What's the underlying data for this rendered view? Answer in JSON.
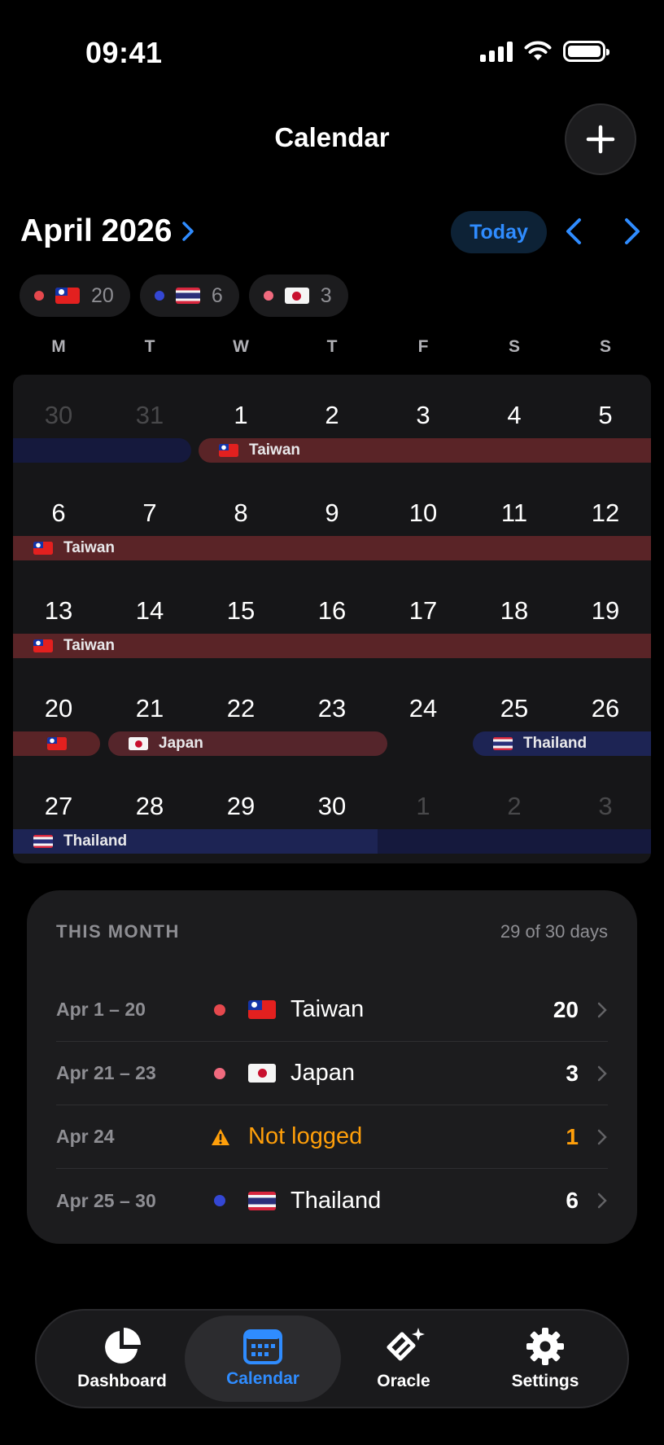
{
  "status": {
    "time": "09:41"
  },
  "nav": {
    "title": "Calendar"
  },
  "month": {
    "title": "April 2026",
    "today_label": "Today"
  },
  "chips": [
    {
      "dot_color": "#e5484d",
      "flag": "taiwan",
      "count": "20"
    },
    {
      "dot_color": "#3447d4",
      "flag": "thailand",
      "count": "6"
    },
    {
      "dot_color": "#f06a7e",
      "flag": "japan",
      "count": "3"
    }
  ],
  "weekdays": [
    "M",
    "T",
    "W",
    "T",
    "F",
    "S",
    "S"
  ],
  "weeks": [
    [
      "30",
      "31",
      "1",
      "2",
      "3",
      "4",
      "5"
    ],
    [
      "6",
      "7",
      "8",
      "9",
      "10",
      "11",
      "12"
    ],
    [
      "13",
      "14",
      "15",
      "16",
      "17",
      "18",
      "19"
    ],
    [
      "20",
      "21",
      "22",
      "23",
      "24",
      "25",
      "26"
    ],
    [
      "27",
      "28",
      "29",
      "30",
      "1",
      "2",
      "3"
    ]
  ],
  "bar_labels": {
    "taiwan": "Taiwan",
    "japan": "Japan",
    "thailand": "Thailand"
  },
  "summary": {
    "title": "THIS MONTH",
    "subtitle": "29 of 30 days",
    "rows": [
      {
        "range": "Apr 1 – 20",
        "place": "Taiwan",
        "count": "20",
        "dot_color": "#e5484d"
      },
      {
        "range": "Apr 21 – 23",
        "place": "Japan",
        "count": "3",
        "dot_color": "#f06a7e"
      },
      {
        "range": "Apr 24",
        "place": "Not logged",
        "count": "1",
        "status": "warning"
      },
      {
        "range": "Apr 25 – 30",
        "place": "Thailand",
        "count": "6",
        "dot_color": "#3447d4"
      }
    ]
  },
  "tabs": [
    {
      "label": "Dashboard",
      "icon": "pie-chart-icon"
    },
    {
      "label": "Calendar",
      "icon": "calendar-icon",
      "active": true
    },
    {
      "label": "Oracle",
      "icon": "oracle-icon"
    },
    {
      "label": "Settings",
      "icon": "gear-icon"
    }
  ],
  "colors": {
    "accent": "#2f8cff",
    "warning": "#ff9f0a"
  }
}
